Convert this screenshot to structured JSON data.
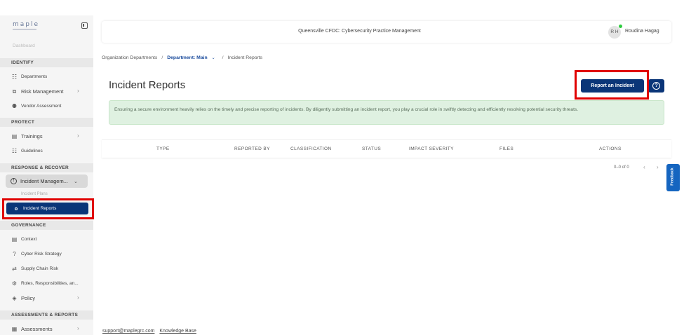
{
  "sidebar": {
    "logo": "maple",
    "dashboard": "Dashboard",
    "sections": {
      "identify": "IDENTIFY",
      "protect": "PROTECT",
      "response": "RESPONSE & RECOVER",
      "governance": "GOVERNANCE",
      "assessments": "ASSESSMENTS & REPORTS"
    },
    "items": {
      "departments": "Departments",
      "risk_management": "Risk Management",
      "vendor_assessment": "Vendor Assessment",
      "trainings": "Trainings",
      "guidelines": "Guidelines",
      "incident_management": "Incident Managem...",
      "incident_plans": "Incident Plans",
      "incident_reports": "Incident Reports",
      "context": "Context",
      "cyber_risk_strategy": "Cyber Risk Strategy",
      "supply_chain_risk": "Supply Chain Risk",
      "roles": "Roles, Responsibilities, an...",
      "policy": "Policy",
      "assessments": "Assessments"
    }
  },
  "header": {
    "title": "Queensville CFDC: Cybersecurity Practice Management",
    "avatar_initials": "R H",
    "user_name": "Roudina Hagag"
  },
  "breadcrumb": {
    "org": "Organization Departments",
    "sep1": "/",
    "dept": "Department: Main",
    "sep2": "/",
    "current": "Incident Reports"
  },
  "main": {
    "title": "Incident Reports",
    "report_button": "Report an Incident",
    "help_glyph": "?",
    "banner": "Ensuring a secure environment heavily relies on the timely and precise reporting of incidents. By diligently submitting an incident report, you play a crucial role in swiftly detecting and efficiently resolving potential security threats.",
    "columns": [
      "TYPE",
      "REPORTED BY",
      "CLASSIFICATION",
      "STATUS",
      "IMPACT SEVERITY",
      "FILES",
      "ACTIONS"
    ],
    "pagination": "0–0 of 0"
  },
  "footer": {
    "support": "support@maplegrc.com",
    "kb": "Knowledge Base"
  },
  "feedback": "Feedback",
  "colors": {
    "primary": "#0a3578",
    "banner_bg": "#dff1e1",
    "highlight": "#e00000"
  }
}
